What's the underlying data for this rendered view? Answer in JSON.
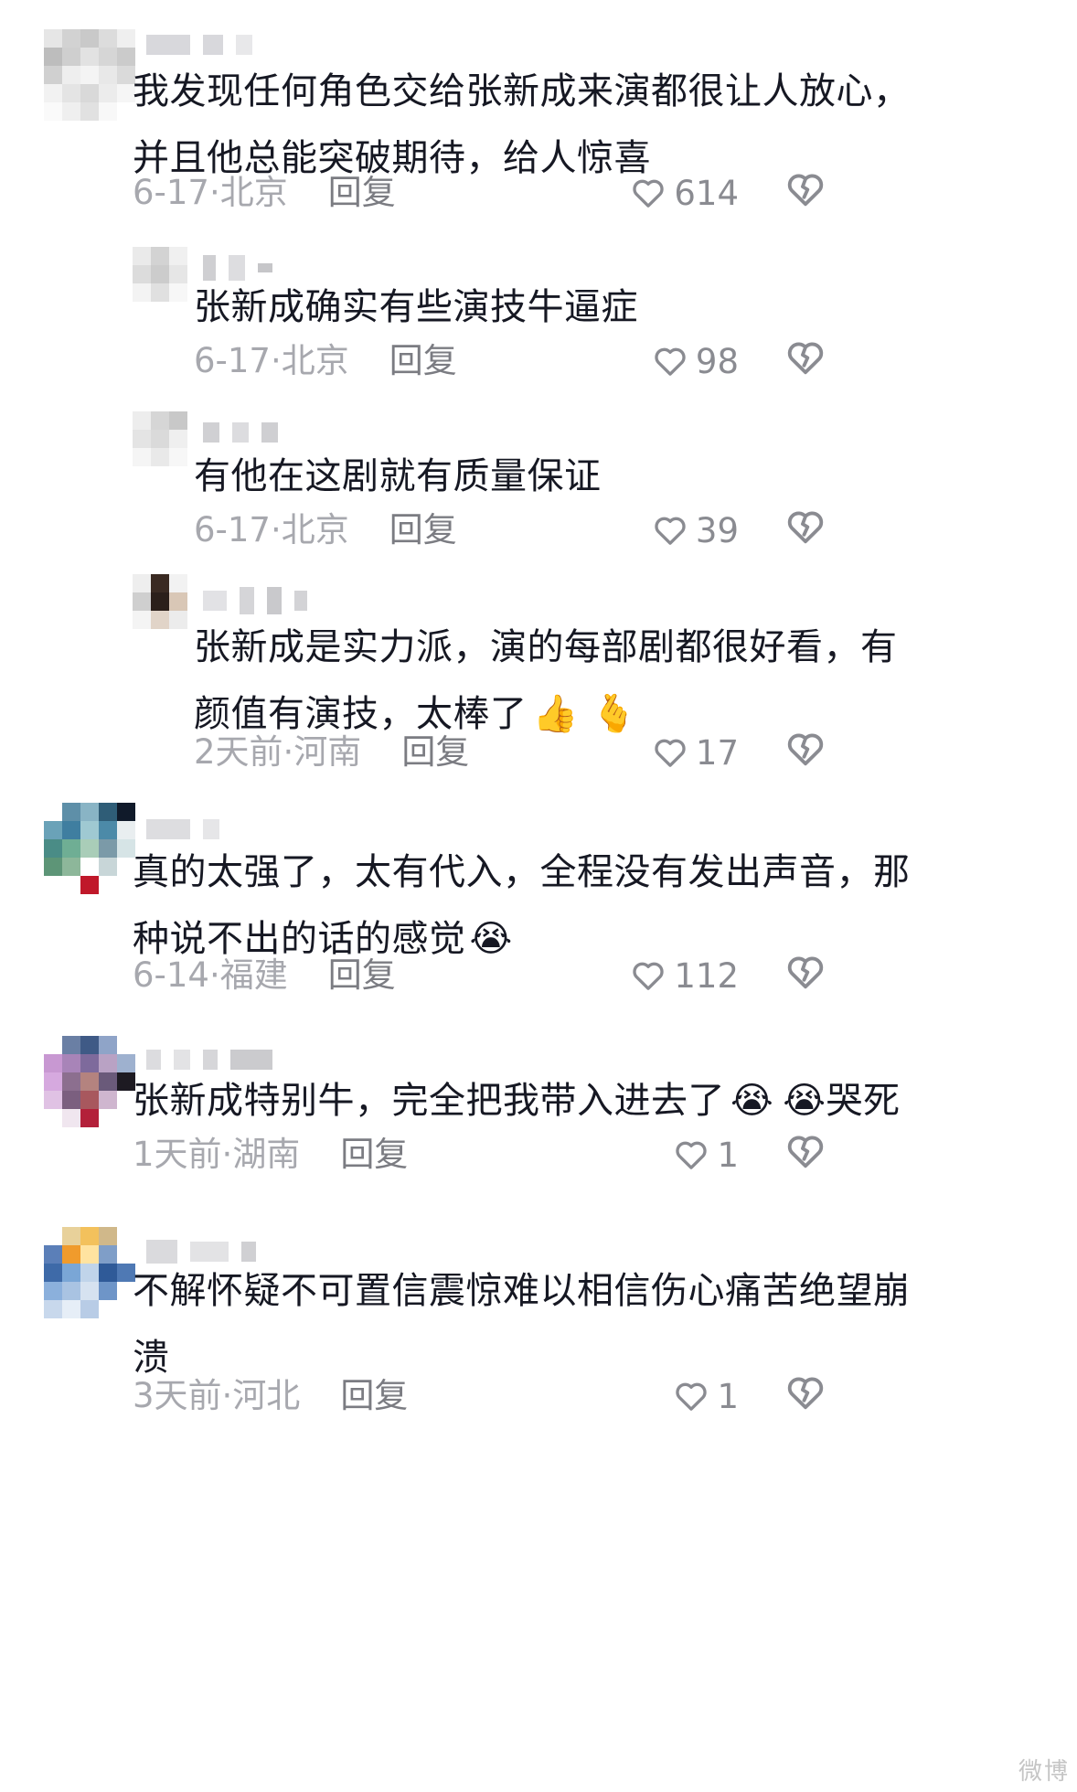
{
  "comments": [
    {
      "text_lines": [
        "我发现任何角色交给张新成来演都很让人放心，",
        "并且他总能突破期待，给人惊喜"
      ],
      "time": "6-17·",
      "location": "北京",
      "reply_label": "回复",
      "likes": "614"
    },
    {
      "text_lines": [
        "张新成确实有些演技牛逼症"
      ],
      "time": "6-17·",
      "location": "北京",
      "reply_label": "回复",
      "likes": "98"
    },
    {
      "text_lines": [
        "有他在这剧就有质量保证"
      ],
      "time": "6-17·",
      "location": "北京",
      "reply_label": "回复",
      "likes": "39"
    },
    {
      "text_lines": [
        "张新成是实力派，演的每部剧都很好看，有",
        "颜值有演技，太棒了"
      ],
      "emojis": [
        "👍",
        "🫰"
      ],
      "time": "2天前·",
      "location": "河南",
      "reply_label": "回复",
      "likes": "17"
    },
    {
      "text_lines": [
        "真的太强了，太有代入，全程没有发出声音，那",
        "种说不出的话的感觉"
      ],
      "emojis": [
        "😭"
      ],
      "time": "6-14·",
      "location": "福建",
      "reply_label": "回复",
      "likes": "112"
    },
    {
      "text_lines": [
        "张新成特别牛，完全把我带入进去了"
      ],
      "text_tail": "哭死",
      "emojis": [
        "😭",
        "😭"
      ],
      "time": "1天前·",
      "location": "湖南",
      "reply_label": "回复",
      "likes": "1"
    },
    {
      "text_lines": [
        "不解怀疑不可置信震惊难以相信伤心痛苦绝望崩",
        "溃"
      ],
      "time": "3天前·",
      "location": "河北",
      "reply_label": "回复",
      "likes": "1"
    }
  ],
  "icons": {
    "like": "heart-outline-icon",
    "dislike": "broken-heart-icon"
  },
  "watermark": "微博"
}
